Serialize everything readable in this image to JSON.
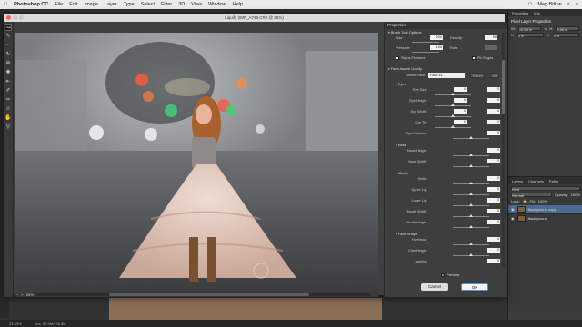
{
  "menubar": {
    "apple": "",
    "app": "Photoshop CC",
    "items": [
      "File",
      "Edit",
      "Image",
      "Layer",
      "Type",
      "Select",
      "Filter",
      "3D",
      "View",
      "Window",
      "Help"
    ],
    "user": "Meg Bitton"
  },
  "window": {
    "title": "Liquify (IMP_A748.CR2 @ 25%)"
  },
  "tools": [
    "forward-warp",
    "reconstruct",
    "smooth",
    "twirl",
    "pucker",
    "bloat",
    "push-left",
    "freeze-mask",
    "thaw-mask",
    "face",
    "hand",
    "zoom"
  ],
  "zoom": "25%",
  "properties": {
    "header": "Properties",
    "brush_options": {
      "title": "Brush Tool Options",
      "size_label": "Size:",
      "size": "200",
      "density_label": "Density:",
      "density": "50",
      "pressure_label": "Pressure:",
      "pressure": "100",
      "rate_label": "Rate:",
      "rate": "",
      "stylus_label": "Stylus Pressure",
      "pin_label": "Pin Edges"
    },
    "face_aware": {
      "title": "Face-Aware Liquify",
      "select_face_label": "Select Face:",
      "select_face": "Face #1",
      "reset": "Reset",
      "all": "All"
    },
    "eyes": {
      "title": "Eyes",
      "rows": [
        {
          "label": "Eye Size:",
          "left": "0",
          "right": "0"
        },
        {
          "label": "Eye Height:",
          "left": "0",
          "right": "0"
        },
        {
          "label": "Eye Width:",
          "left": "0",
          "right": "0"
        },
        {
          "label": "Eye Tilt:",
          "left": "0",
          "right": "0"
        },
        {
          "label": "Eye Distance:",
          "left": "",
          "right": "0"
        }
      ]
    },
    "nose": {
      "title": "Nose",
      "rows": [
        {
          "label": "Nose Height:",
          "value": "0"
        },
        {
          "label": "Nose Width:",
          "value": "0"
        }
      ]
    },
    "mouth": {
      "title": "Mouth",
      "rows": [
        {
          "label": "Smile:",
          "value": "0"
        },
        {
          "label": "Upper Lip:",
          "value": "0"
        },
        {
          "label": "Lower Lip:",
          "value": "0"
        },
        {
          "label": "Mouth Width:",
          "value": "0"
        },
        {
          "label": "Mouth Height:",
          "value": "0"
        }
      ]
    },
    "face_shape": {
      "title": "Face Shape",
      "rows": [
        {
          "label": "Forehead:",
          "value": "0"
        },
        {
          "label": "Chin Height:",
          "value": "0"
        },
        {
          "label": "Jawline:",
          "value": "0"
        }
      ]
    },
    "preview_label": "Preview",
    "cancel": "Cancel",
    "ok": "OK"
  },
  "right_panel": {
    "tabs": [
      "Properties",
      "Info"
    ],
    "title": "Pixel Layer Properties",
    "w_label": "W:",
    "w": "12.84 in",
    "h_label": "H:",
    "h": "8.56 in",
    "x_label": "X:",
    "x": "0 in",
    "y_label": "Y:",
    "y": "0 in",
    "layers_tabs": [
      "Layers",
      "Channels",
      "Paths"
    ],
    "kind": "Kind",
    "blend": "Normal",
    "opacity_label": "Opacity:",
    "opacity": "100%",
    "lock_label": "Lock:",
    "fill_label": "Fill:",
    "fill": "100%",
    "layers": [
      {
        "name": "Background copy",
        "selected": true
      },
      {
        "name": "Background",
        "selected": false
      }
    ]
  },
  "status": {
    "zoom": "33.33%",
    "doc": "Doc: 97.9M/195.8M"
  },
  "colors": {
    "accent": "#4a90d9",
    "selected_layer": "#4d6a8f"
  }
}
